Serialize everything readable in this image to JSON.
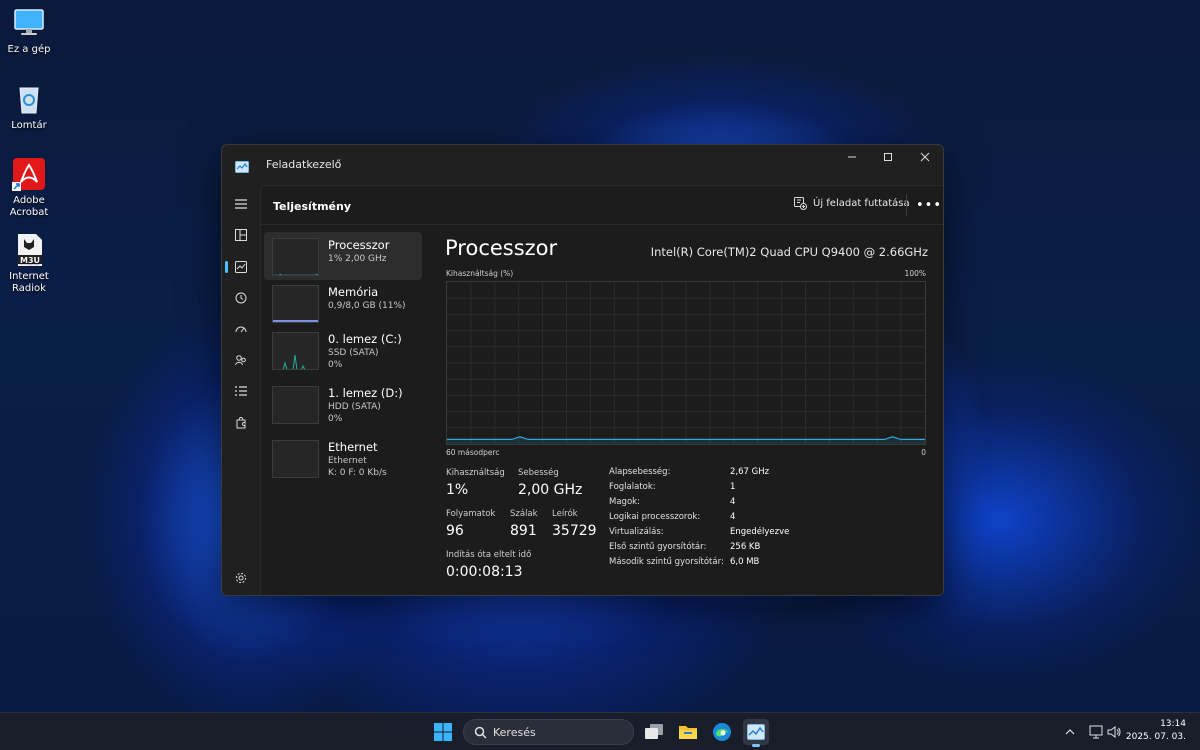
{
  "desktop": {
    "icons": [
      {
        "label": "Ez a gép"
      },
      {
        "label": "Lomtár"
      },
      {
        "label": "Adobe Acrobat"
      },
      {
        "label": "Internet Radiok",
        "badge": "M3U"
      }
    ]
  },
  "window": {
    "title": "Feladatkezelő",
    "header": {
      "page_title": "Teljesítmény",
      "run_task_label": "Új feladat futtatása",
      "more_label": "•••"
    },
    "resources": [
      {
        "name": "Processzor",
        "sub1": "1%  2,00 GHz",
        "sub2": ""
      },
      {
        "name": "Memória",
        "sub1": "0,9/8,0 GB (11%)",
        "sub2": ""
      },
      {
        "name": "0. lemez (C:)",
        "sub1": "SSD (SATA)",
        "sub2": "0%"
      },
      {
        "name": "1. lemez (D:)",
        "sub1": "HDD (SATA)",
        "sub2": "0%"
      },
      {
        "name": "Ethernet",
        "sub1": "Ethernet",
        "sub2": "K: 0 F: 0 Kb/s"
      }
    ],
    "main": {
      "title": "Processzor",
      "cpu_model": "Intel(R) Core(TM)2 Quad CPU Q9400 @ 2.66GHz",
      "graph_label": "Kihasználtság (%)",
      "graph_max": "100%",
      "graph_time": "60 másodperc",
      "graph_min": "0",
      "stats": {
        "util_label": "Kihasználtság",
        "util_value": "1%",
        "speed_label": "Sebesség",
        "speed_value": "2,00 GHz",
        "proc_label": "Folyamatok",
        "proc_value": "96",
        "threads_label": "Szálak",
        "threads_value": "891",
        "handles_label": "Leírók",
        "handles_value": "35729",
        "uptime_label": "Indítás óta eltelt idő",
        "uptime_value": "0:00:08:13"
      },
      "details": [
        {
          "k": "Alapsebesség:",
          "v": "2,67 GHz"
        },
        {
          "k": "Foglalatok:",
          "v": "1"
        },
        {
          "k": "Magok:",
          "v": "4"
        },
        {
          "k": "Logikai processzorok:",
          "v": "4"
        },
        {
          "k": "Virtualizálás:",
          "v": "Engedélyezve"
        },
        {
          "k": "Első szintű gyorsítótár:",
          "v": "256 KB"
        },
        {
          "k": "Második szintű gyorsítótár:",
          "v": "6,0 MB"
        }
      ],
      "cpu_history_percent": [
        1,
        1,
        1,
        1,
        1,
        1,
        1,
        1,
        1,
        2,
        1,
        1,
        1,
        1,
        1,
        1,
        1,
        1,
        1,
        1,
        1,
        1,
        1,
        1,
        1,
        1,
        1,
        1,
        1,
        1,
        1,
        1,
        1,
        1,
        1,
        1,
        1,
        1,
        1,
        1,
        1,
        1,
        1,
        1,
        1,
        1,
        1,
        1,
        1,
        1,
        1,
        1,
        1,
        1,
        1,
        2,
        1,
        1,
        1,
        1
      ],
      "colors": {
        "cpu": "#2fa8d8",
        "memory": "#7b8ee8",
        "disk": "#1fb09a",
        "ethernet": "#c050a8"
      }
    }
  },
  "taskbar": {
    "search_label": "Keresés",
    "time": "13:14",
    "date": "2025. 07. 03."
  }
}
